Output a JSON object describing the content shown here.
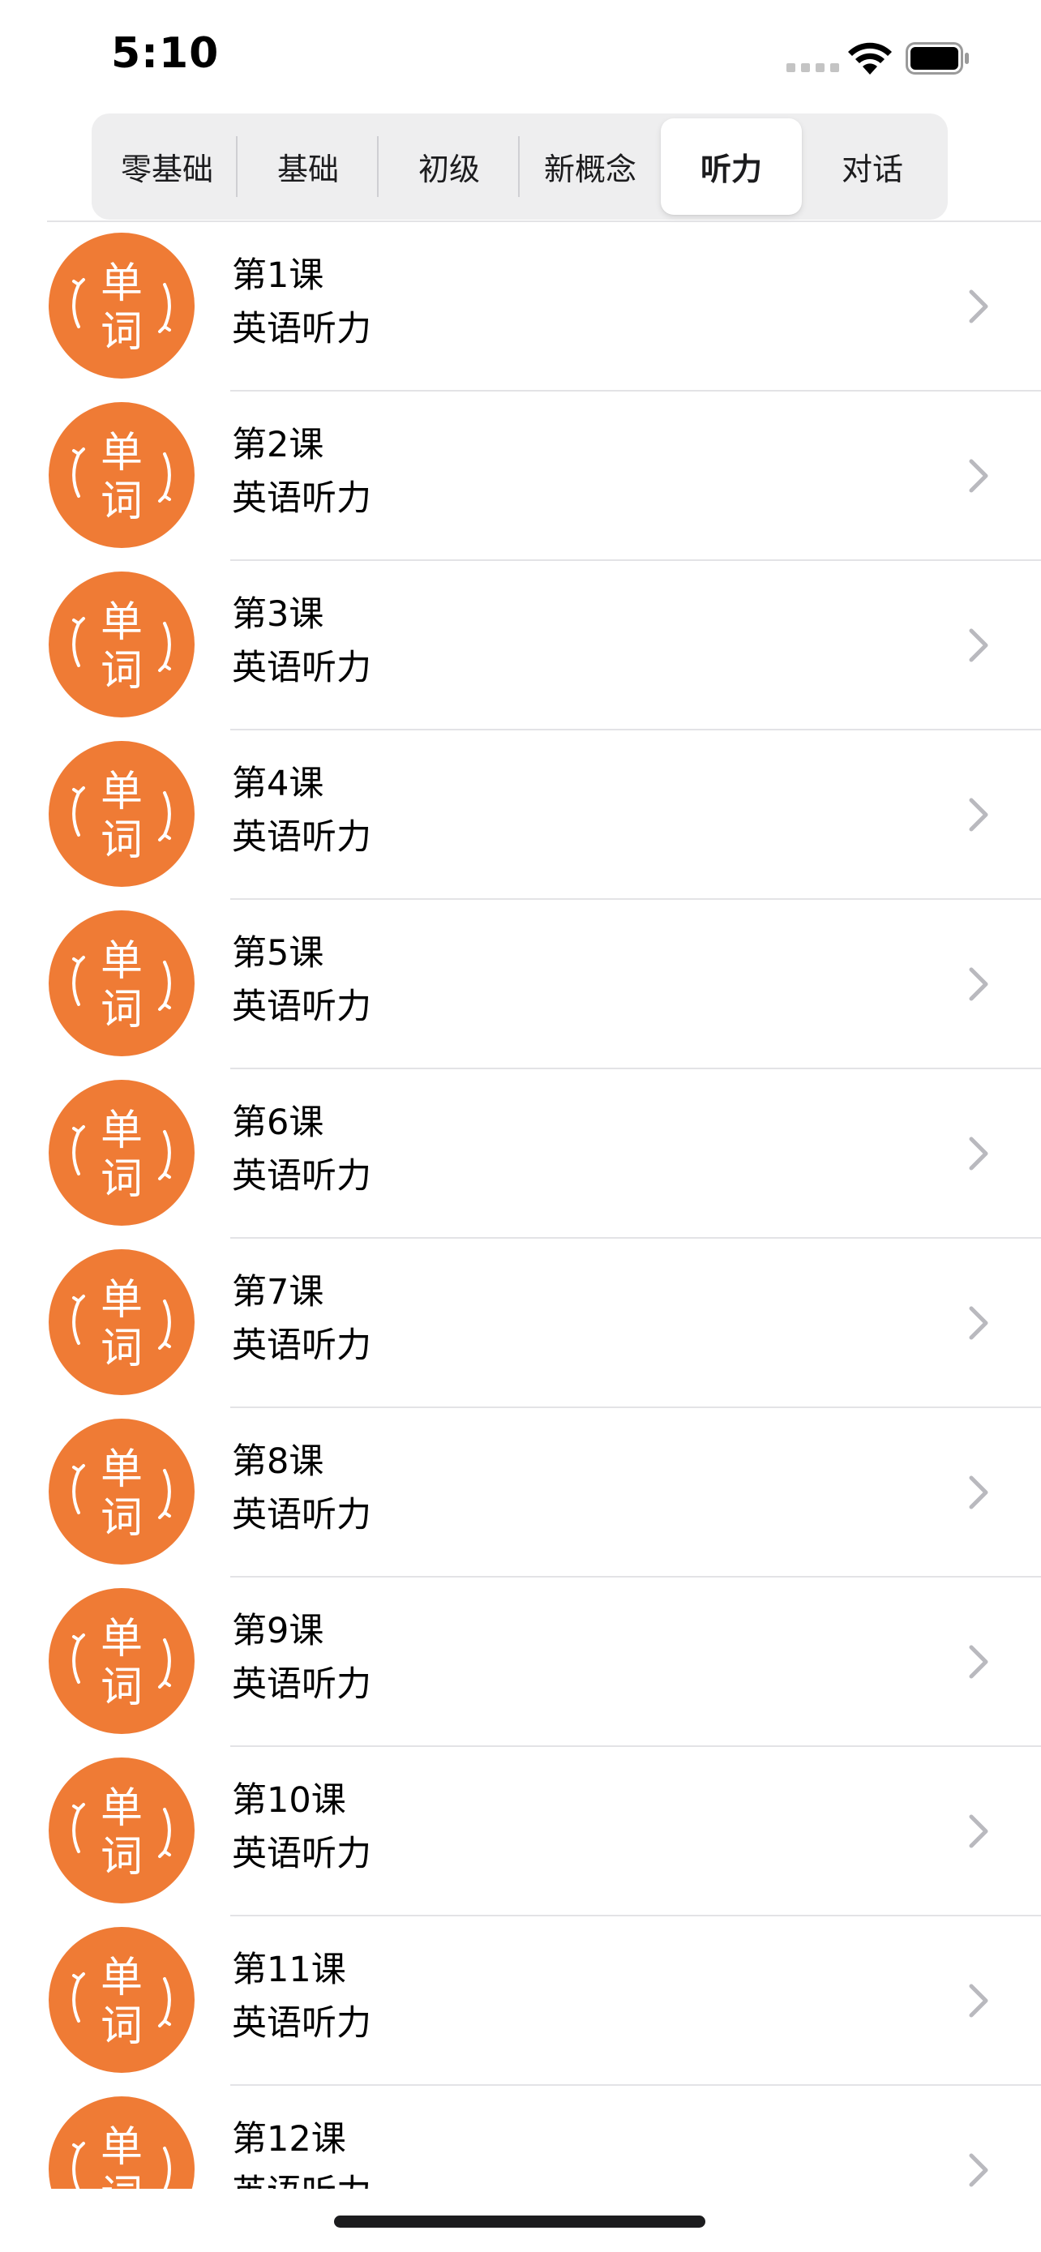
{
  "status_bar": {
    "time": "5:10"
  },
  "segments": [
    {
      "label": "零基础",
      "selected": false
    },
    {
      "label": "基础",
      "selected": false
    },
    {
      "label": "初级",
      "selected": false
    },
    {
      "label": "新概念",
      "selected": false
    },
    {
      "label": "听力",
      "selected": true
    },
    {
      "label": "对话",
      "selected": false
    }
  ],
  "icon": {
    "name": "word-badge-icon",
    "glyph_top": "单",
    "glyph_bottom": "词",
    "color": "#ef7b35"
  },
  "lessons": [
    {
      "title": "第1课",
      "subtitle": "英语听力"
    },
    {
      "title": "第2课",
      "subtitle": "英语听力"
    },
    {
      "title": "第3课",
      "subtitle": "英语听力"
    },
    {
      "title": "第4课",
      "subtitle": "英语听力"
    },
    {
      "title": "第5课",
      "subtitle": "英语听力"
    },
    {
      "title": "第6课",
      "subtitle": "英语听力"
    },
    {
      "title": "第7课",
      "subtitle": "英语听力"
    },
    {
      "title": "第8课",
      "subtitle": "英语听力"
    },
    {
      "title": "第9课",
      "subtitle": "英语听力"
    },
    {
      "title": "第10课",
      "subtitle": "英语听力"
    },
    {
      "title": "第11课",
      "subtitle": "英语听力"
    },
    {
      "title": "第12课",
      "subtitle": "英语听力"
    }
  ]
}
